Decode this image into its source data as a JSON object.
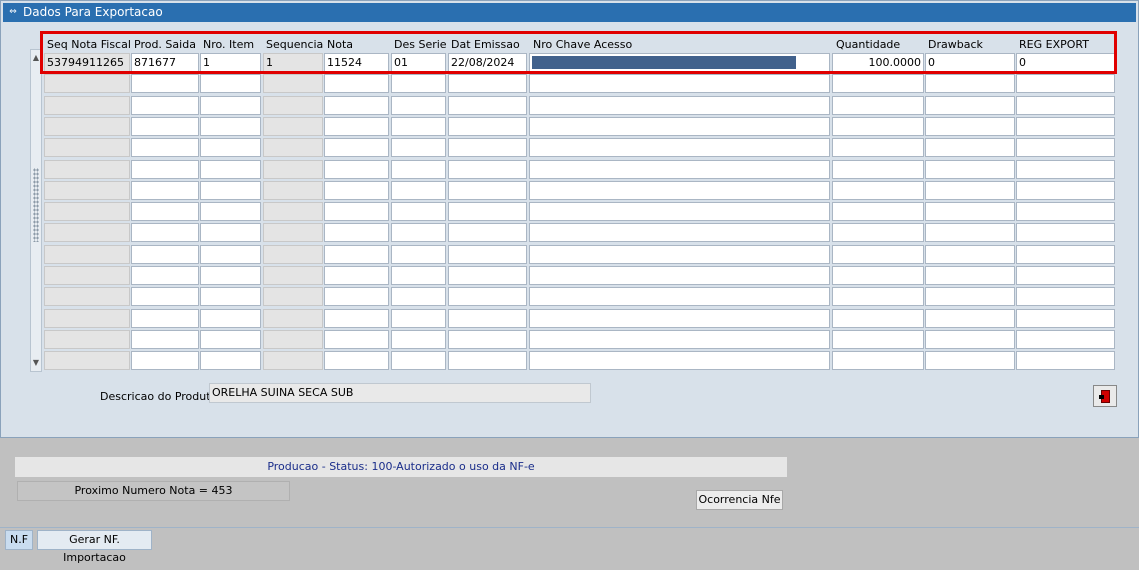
{
  "window": {
    "title": "Dados Para Exportacao",
    "title_icon": "form-icon"
  },
  "table": {
    "columns": [
      "Seq Nota Fiscal",
      "Prod. Saida",
      "Nro. Item",
      "Sequencia",
      "Nota",
      "Des Serie",
      "Dat Emissao",
      "Nro Chave Acesso",
      "Quantidade",
      "Drawback",
      "REG EXPORT"
    ],
    "row": {
      "seq_nota_fiscal": "53794911265",
      "prod_saida": "871677",
      "nro_item": "1",
      "sequencia": "1",
      "nota": "11524",
      "des_serie": "01",
      "dat_emissao": "22/08/2024",
      "nro_chave_acesso": "",
      "quantidade": "100.0000",
      "drawback": "0",
      "reg_export": "0"
    }
  },
  "product": {
    "label": "Descricao do Produto",
    "value": "ORELHA SUINA SECA SUB"
  },
  "status": {
    "message": "Producao - Status: 100-Autorizado o uso da NF-e",
    "next_note": "Proximo Numero Nota = 453"
  },
  "buttons": {
    "ocorrencia": "Ocorrencia Nfe",
    "exit_icon": "exit-door-icon"
  },
  "tabs": [
    {
      "label": "N.F",
      "active": true
    },
    {
      "label": "Gerar NF. Importacao",
      "active": false
    }
  ],
  "colors": {
    "title_bar": "#2a6fb0",
    "highlight": "#e00000",
    "selection": "#41618c"
  }
}
